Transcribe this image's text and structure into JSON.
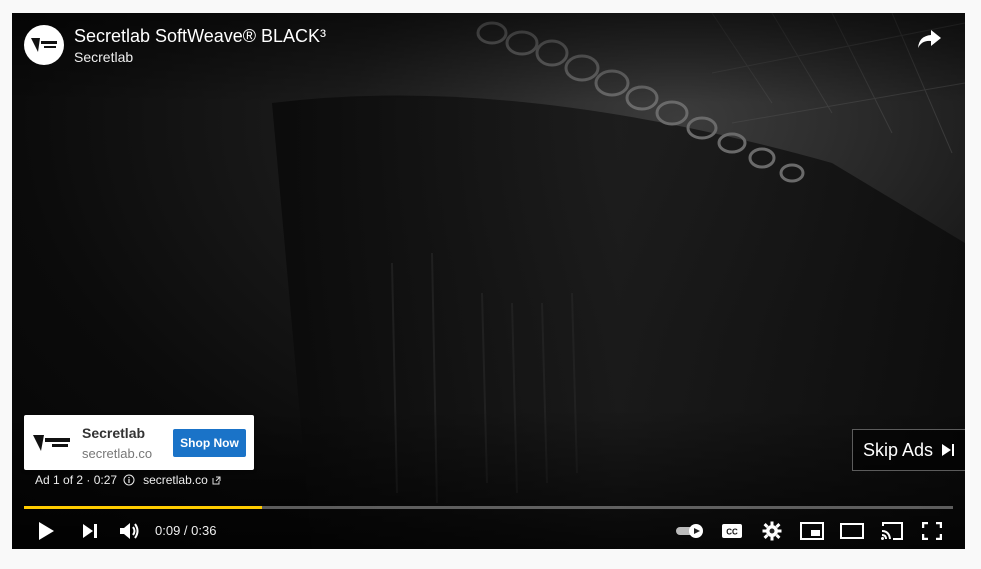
{
  "video": {
    "title": "Secretlab SoftWeave® BLACK³",
    "channel": "Secretlab"
  },
  "ad": {
    "advertiser": "Secretlab",
    "domain": "secretlab.co",
    "cta_label": "Shop Now",
    "info": "Ad 1 of 2 · 0:27",
    "info_link": "secretlab.co",
    "skip_label": "Skip Ads",
    "logo_text": "SECRET LAB"
  },
  "playback": {
    "current_time": "0:09",
    "duration": "0:36",
    "time_display": "0:09 / 0:36",
    "progress_fraction": 0.256
  },
  "colors": {
    "progress_fill": "#ffcc00",
    "cta_background": "#1a73c8"
  },
  "icons": [
    "share-icon",
    "play-icon",
    "next-icon",
    "volume-icon",
    "autoplay-toggle-icon",
    "captions-icon",
    "settings-icon",
    "miniplayer-icon",
    "theater-icon",
    "cast-icon",
    "fullscreen-icon",
    "info-icon",
    "external-link-icon",
    "skip-icon"
  ]
}
